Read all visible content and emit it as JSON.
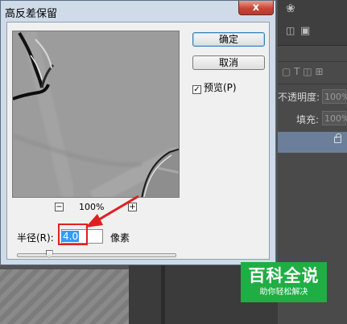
{
  "dialog": {
    "title": "高反差保留",
    "close_glyph": "x",
    "ok_label": "确定",
    "cancel_label": "取消",
    "preview_label": "预览(P)",
    "preview_checked": true,
    "zoom_out": "−",
    "zoom_level": "100%",
    "zoom_in": "+",
    "radius_label": "半径(R):",
    "radius_value": "4.0",
    "unit_label": "像素",
    "slider_fraction": 0.2
  },
  "ps_panel": {
    "opacity_label": "不透明度:",
    "opacity_value": "100%",
    "fill_label": "填充:",
    "fill_value": "100%",
    "lock_icon": "lock-icon"
  },
  "watermark": {
    "title": "百科全说",
    "subtitle": "助你轻松解决"
  },
  "colors": {
    "dialog_frame": "#cfdbe8",
    "client_bg": "#f0f0f0",
    "highlight": "#3399ff",
    "annotation": "#e02020",
    "watermark": "#1fae43"
  }
}
